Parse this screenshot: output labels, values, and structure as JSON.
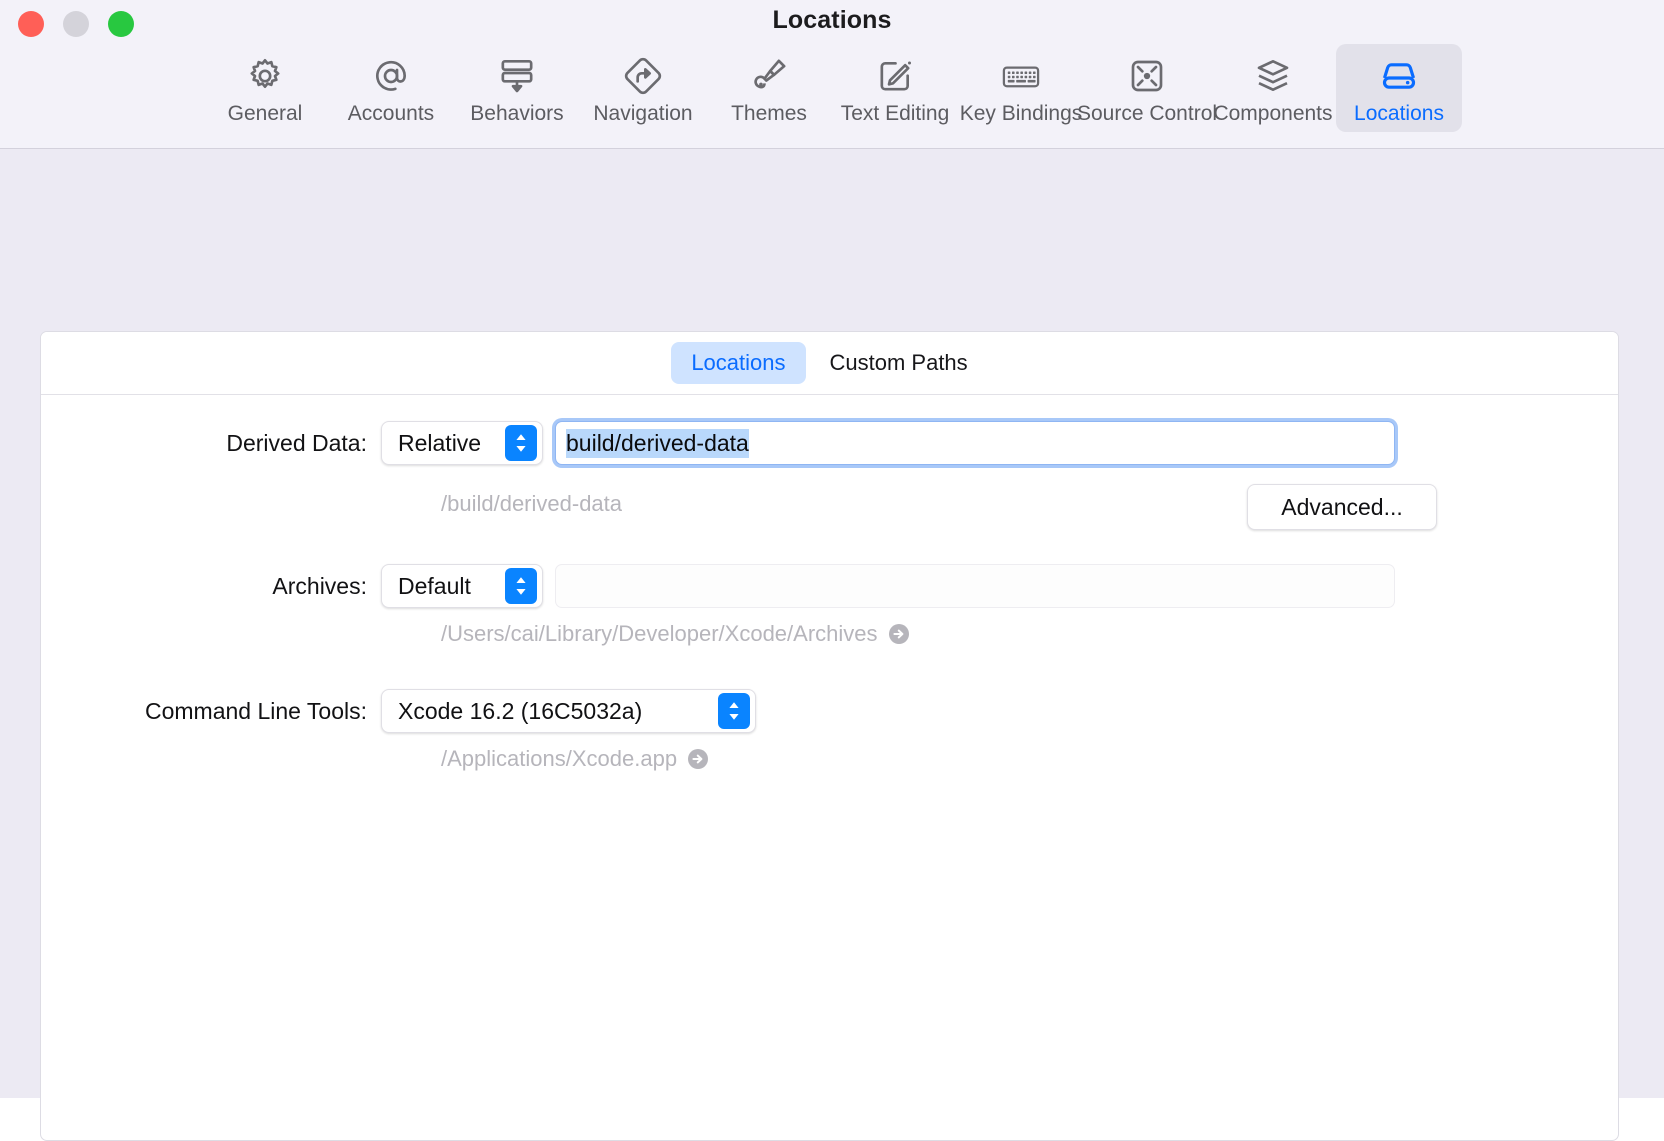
{
  "window": {
    "title": "Locations",
    "traffic_lights": [
      {
        "name": "close",
        "color": "#ff5f57"
      },
      {
        "name": "minimize",
        "color": "#d4d3da"
      },
      {
        "name": "maximize",
        "color": "#28c840"
      }
    ]
  },
  "toolbar": {
    "items": [
      {
        "label": "General",
        "icon": "gear-icon",
        "selected": false
      },
      {
        "label": "Accounts",
        "icon": "at-sign-icon",
        "selected": false
      },
      {
        "label": "Behaviors",
        "icon": "behaviors-icon",
        "selected": false
      },
      {
        "label": "Navigation",
        "icon": "navigation-icon",
        "selected": false
      },
      {
        "label": "Themes",
        "icon": "paintbrush-icon",
        "selected": false
      },
      {
        "label": "Text Editing",
        "icon": "pencil-square-icon",
        "selected": false
      },
      {
        "label": "Key Bindings",
        "icon": "keyboard-icon",
        "selected": false
      },
      {
        "label": "Source Control",
        "icon": "source-control-icon",
        "selected": false
      },
      {
        "label": "Components",
        "icon": "layers-icon",
        "selected": false
      },
      {
        "label": "Locations",
        "icon": "harddisk-icon",
        "selected": true
      }
    ]
  },
  "segmented": {
    "tabs": [
      {
        "label": "Locations",
        "active": true
      },
      {
        "label": "Custom Paths",
        "active": false
      }
    ]
  },
  "form": {
    "derived_data": {
      "label": "Derived Data:",
      "popup_value": "Relative",
      "field_value": "build/derived-data",
      "field_focused": true,
      "field_selected": true,
      "path": "/build/derived-data",
      "advanced_button": "Advanced..."
    },
    "archives": {
      "label": "Archives:",
      "popup_value": "Default",
      "field_value": "",
      "field_disabled": true,
      "path": "/Users/cai/Library/Developer/Xcode/Archives",
      "reveal_icon": "arrow-right-circle-icon"
    },
    "command_line_tools": {
      "label": "Command Line Tools:",
      "popup_value": "Xcode 16.2 (16C5032a)",
      "path": "/Applications/Xcode.app",
      "reveal_icon": "arrow-right-circle-icon"
    }
  },
  "colors": {
    "accent": "#0a6cff",
    "popup_chevron_bg": "#0a84ff",
    "selection_highlight": "#b9d8fb",
    "segment_active_bg": "#cfe3ff",
    "toolbar_bg": "#f3f2f9",
    "window_bg": "#eceaf3",
    "path_text": "#b6b5bb"
  }
}
